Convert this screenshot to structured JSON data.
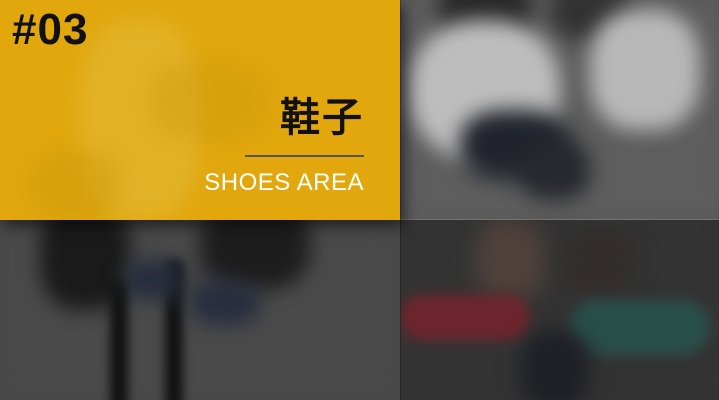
{
  "section": {
    "number": "#03",
    "title_cn": "鞋子",
    "title_en": "SHOES AREA"
  },
  "colors": {
    "accent_yellow": "#F0B20C",
    "title_text": "#111111",
    "subtitle_text": "#FFFFFF",
    "divider": "#555555"
  },
  "background_photos": [
    "man-sitting-on-stool-photo",
    "sneakers-on-concrete-photo",
    "man-legs-stool-photo",
    "shoes-circle-photo"
  ]
}
